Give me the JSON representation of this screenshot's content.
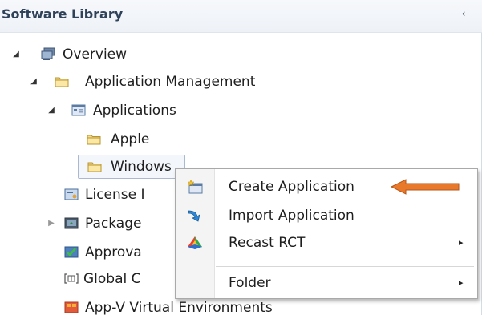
{
  "header": {
    "title": "Software Library",
    "collapse_glyph": "‹"
  },
  "tree": {
    "overview": "Overview",
    "application_management": "Application Management",
    "applications": "Applications",
    "apple": "Apple",
    "windows": "Windows",
    "license": "License I",
    "packages": "Package",
    "approval": "Approva",
    "global": "Global C",
    "appv": "App-V Virtual Environments"
  },
  "context_menu": {
    "items": [
      {
        "label": "Create Application",
        "icon": "new-application-icon",
        "has_submenu": false
      },
      {
        "label": "Import Application",
        "icon": "import-arrow-icon",
        "has_submenu": false
      },
      {
        "label": "Recast RCT",
        "icon": "recast-rct-icon",
        "has_submenu": true
      },
      {
        "label": "Folder",
        "icon": "",
        "has_submenu": true
      }
    ],
    "submenu_glyph": "▸"
  },
  "annotation": {
    "color": "#e8782a"
  }
}
